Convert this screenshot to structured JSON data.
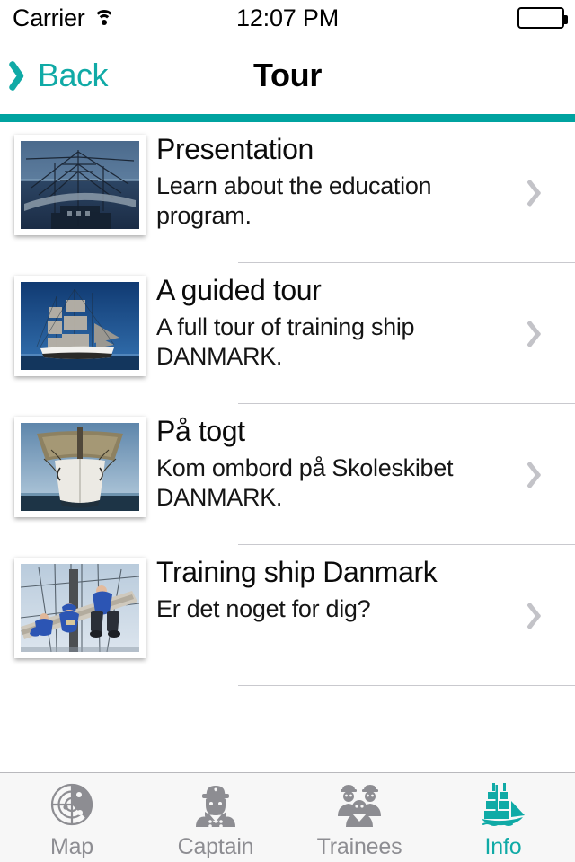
{
  "status_bar": {
    "carrier": "Carrier",
    "wifi_icon": "wifi-icon",
    "time": "12:07 PM",
    "battery_icon": "battery-full-icon",
    "battery_level": 100
  },
  "nav_bar": {
    "back_icon": "chevron-left-icon",
    "back_label": "Back",
    "title": "Tour",
    "accent_color": "#00A3A0",
    "tint_color": "#10AAA6"
  },
  "list": {
    "rows": [
      {
        "title": "Presentation",
        "subtitle": "Learn about the education program.",
        "thumbnail_name": "ship-rigging-at-dusk-photo",
        "disclosure_icon": "chevron-right-icon"
      },
      {
        "title": "A guided tour",
        "subtitle": "A full tour of training ship DANMARK.",
        "thumbnail_name": "full-rigged-ship-under-sail-photo",
        "disclosure_icon": "chevron-right-icon"
      },
      {
        "title": "På togt",
        "subtitle": "Kom ombord på Skoleskibet DANMARK.",
        "thumbnail_name": "ship-bow-head-on-photo",
        "disclosure_icon": "chevron-right-icon"
      },
      {
        "title": "Training ship Danmark",
        "subtitle": "Er det noget for dig?",
        "thumbnail_name": "trainees-on-yardarm-photo",
        "disclosure_icon": "chevron-right-icon"
      }
    ]
  },
  "tab_bar": {
    "active_index": 3,
    "inactive_color": "#8d8d92",
    "active_color": "#10AAA6",
    "tabs": [
      {
        "label": "Map",
        "icon": "radar-icon"
      },
      {
        "label": "Captain",
        "icon": "captain-icon"
      },
      {
        "label": "Trainees",
        "icon": "trainees-icon"
      },
      {
        "label": "Info",
        "icon": "sailing-ship-icon"
      }
    ]
  }
}
